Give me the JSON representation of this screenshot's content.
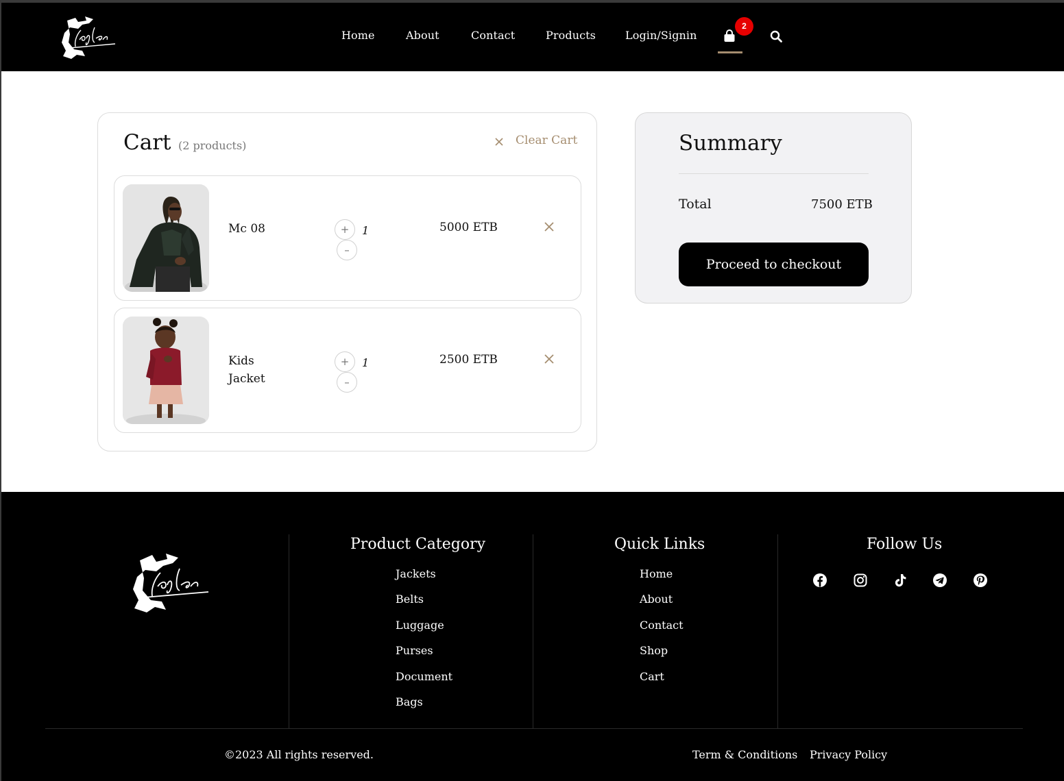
{
  "brand": {
    "logo_text": "Joy leather"
  },
  "nav": {
    "items": [
      "Home",
      "About",
      "Contact",
      "Products",
      "Login/Signin"
    ],
    "cart_badge": "2",
    "icons": {
      "cart": "shopping-bag-icon",
      "search": "search-icon"
    }
  },
  "cart": {
    "title": "Cart",
    "count_label": "(2 products)",
    "clear_label": "Clear Cart",
    "items": [
      {
        "name": "Mc 08",
        "qty": "1",
        "price": "5000 ETB",
        "image": "man-in-leather-jacket-photo"
      },
      {
        "name": "Kids Jacket",
        "qty": "1",
        "price": "2500 ETB",
        "image": "child-in-red-jacket-photo"
      }
    ],
    "plus_label": "+",
    "minus_label": "–"
  },
  "summary": {
    "title": "Summary",
    "total_label": "Total",
    "total_value": "7500 ETB",
    "checkout_label": "Proceed to checkout"
  },
  "footer": {
    "product_category": {
      "title": "Product Category",
      "links": [
        "Jackets",
        "Belts",
        "Luggage",
        "Purses",
        "Document",
        "Bags"
      ]
    },
    "quick_links": {
      "title": "Quick Links",
      "links": [
        "Home",
        "About",
        "Contact",
        "Shop",
        "Cart"
      ]
    },
    "follow_us": {
      "title": "Follow Us",
      "icons": [
        "facebook-icon",
        "instagram-icon",
        "tiktok-icon",
        "telegram-icon",
        "pinterest-icon"
      ]
    },
    "copyright": "©2023 All rights reserved.",
    "terms": "Term & Conditions",
    "privacy": "Privacy Policy"
  },
  "colors": {
    "accent": "#a58d6f",
    "badge": "#e60000",
    "header_bg": "#000000",
    "summary_bg": "#f2f2f4"
  }
}
